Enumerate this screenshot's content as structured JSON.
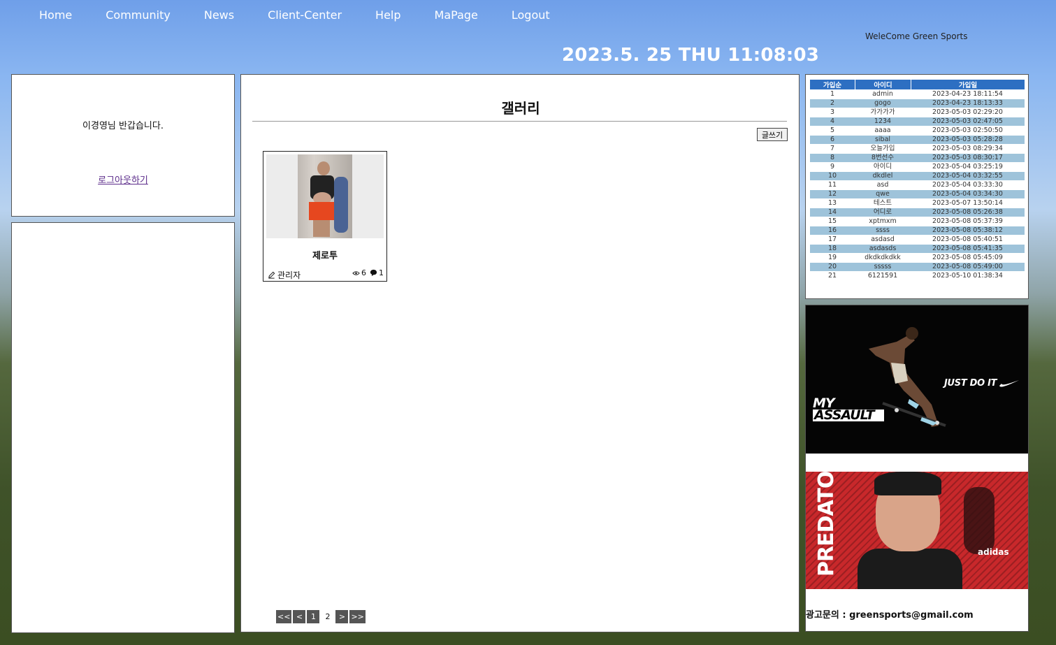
{
  "nav": {
    "items": [
      "Home",
      "Community",
      "News",
      "Client-Center",
      "Help",
      "MaPage",
      "Logout"
    ]
  },
  "header": {
    "welcome": "WeleCome Green Sports",
    "clock": "2023.5. 25 THU 11:08:03"
  },
  "login_box": {
    "greeting": "이경영님 반갑습니다.",
    "logout_link": "로그아웃하기"
  },
  "gallery": {
    "title": "갤러리",
    "write_button": "글쓰기",
    "posts": [
      {
        "title": "제로투",
        "author": "관리자",
        "views": "6",
        "comments": "1"
      }
    ],
    "pager": {
      "first": "<<",
      "prev": "<",
      "pages": [
        "1",
        "2"
      ],
      "current": "2",
      "next": ">",
      "last": ">>"
    }
  },
  "members": {
    "headers": [
      "가입순",
      "아이디",
      "가입일"
    ],
    "rows": [
      [
        "1",
        "admin",
        "2023-04-23 18:11:54"
      ],
      [
        "2",
        "gogo",
        "2023-04-23 18:13:33"
      ],
      [
        "3",
        "가가가가",
        "2023-05-03 02:29:20"
      ],
      [
        "4",
        "1234",
        "2023-05-03 02:47:05"
      ],
      [
        "5",
        "aaaa",
        "2023-05-03 02:50:50"
      ],
      [
        "6",
        "sibal",
        "2023-05-03 05:28:28"
      ],
      [
        "7",
        "오늘가입",
        "2023-05-03 08:29:34"
      ],
      [
        "8",
        "8번선수",
        "2023-05-03 08:30:17"
      ],
      [
        "9",
        "아이디",
        "2023-05-04 03:25:19"
      ],
      [
        "10",
        "dkdlel",
        "2023-05-04 03:32:55"
      ],
      [
        "11",
        "asd",
        "2023-05-04 03:33:30"
      ],
      [
        "12",
        "qwe",
        "2023-05-04 03:34:30"
      ],
      [
        "13",
        "테스트",
        "2023-05-07 13:50:14"
      ],
      [
        "14",
        "어디로",
        "2023-05-08 05:26:38"
      ],
      [
        "15",
        "xptmxm",
        "2023-05-08 05:37:39"
      ],
      [
        "16",
        "ssss",
        "2023-05-08 05:38:12"
      ],
      [
        "17",
        "asdasd",
        "2023-05-08 05:40:51"
      ],
      [
        "18",
        "asdasds",
        "2023-05-08 05:41:35"
      ],
      [
        "19",
        "dkdkdkdkk",
        "2023-05-08 05:45:09"
      ],
      [
        "20",
        "sssss",
        "2023-05-08 05:49:00"
      ],
      [
        "21",
        "6121591",
        "2023-05-10 01:38:34"
      ]
    ]
  },
  "ads": {
    "nike": {
      "slogan": "JUST DO IT",
      "line1": "MY",
      "line2": "ASSAULT"
    },
    "adidas": {
      "word": "PREDATOR",
      "brand": "adidas"
    },
    "contact": "광고문의 : greensports@gmail.com"
  }
}
